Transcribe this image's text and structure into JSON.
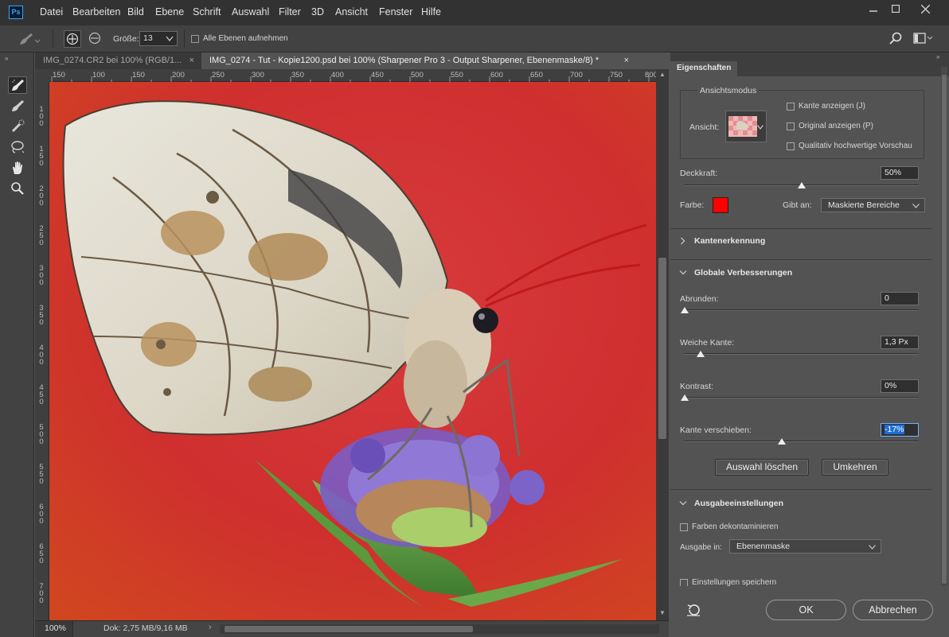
{
  "app": {
    "logo": "Ps"
  },
  "menu": [
    "Datei",
    "Bearbeiten",
    "Bild",
    "Ebene",
    "Schrift",
    "Auswahl",
    "Filter",
    "3D",
    "Ansicht",
    "Fenster",
    "Hilfe"
  ],
  "options": {
    "size_label": "Größe:",
    "size_value": "13",
    "all_layers_label": "Alle Ebenen aufnehmen"
  },
  "tabs": [
    {
      "label": "IMG_0274.CR2 bei 100% (RGB/1...",
      "close": "×",
      "active": false
    },
    {
      "label": "IMG_0274 - Tut - Kopie1200.psd bei 100% (Sharpener Pro 3 - Output Sharpener, Ebenenmaske/8) *",
      "close": "×",
      "active": true
    }
  ],
  "ruler_h": [
    "150",
    "100",
    "150",
    "200",
    "250",
    "300",
    "350",
    "400",
    "450",
    "500",
    "550",
    "600",
    "650",
    "700",
    "750",
    "800",
    "8"
  ],
  "ruler_v": [
    "1\n0\n0",
    "1\n5\n0",
    "2\n0\n0",
    "2\n5\n0",
    "3\n0\n0",
    "3\n5\n0",
    "4\n0\n0",
    "4\n5\n0",
    "5\n0\n0",
    "5\n5\n0",
    "6\n0\n0",
    "6\n5\n0",
    "7\n0\n0",
    "7\n5\n0"
  ],
  "status": {
    "zoom": "100%",
    "doc": "Dok: 2,75 MB/9,16 MB"
  },
  "panel": {
    "title": "Eigenschaften",
    "view_mode": {
      "group_label": "Ansichtsmodus",
      "view_label": "Ansicht:",
      "options": [
        "Kante anzeigen (J)",
        "Original anzeigen (P)",
        "Qualitativ hochwertige Vorschau"
      ]
    },
    "opacity": {
      "label": "Deckkraft:",
      "value": "50%",
      "level_percent": 50
    },
    "color": {
      "label": "Farbe:",
      "swatch": "#ff0000"
    },
    "applies_to": {
      "label": "Gibt an:",
      "value": "Maskierte Bereiche"
    },
    "edge_detection": {
      "title": "Kantenerkennung"
    },
    "global": {
      "title": "Globale Verbesserungen",
      "smooth": {
        "label": "Abrunden:",
        "value": "0"
      },
      "feather": {
        "label": "Weiche Kante:",
        "value": "1,3 Px"
      },
      "contrast": {
        "label": "Kontrast:",
        "value": "0%"
      },
      "shift_edge": {
        "label": "Kante verschieben:",
        "value": "-17%"
      },
      "clear_button": "Auswahl löschen",
      "invert_button": "Umkehren"
    },
    "output": {
      "title": "Ausgabeeinstellungen",
      "decontaminate": "Farben dekontaminieren",
      "output_to_label": "Ausgabe in:",
      "output_to_value": "Ebenenmaske",
      "save_settings": "Einstellungen speichern"
    },
    "ok": "OK",
    "cancel": "Abbrechen"
  },
  "colors": {
    "accent_selection": "#1d6fd6",
    "canvas_bg": "#d22f2c",
    "ps_blue": "#31a8ff"
  }
}
